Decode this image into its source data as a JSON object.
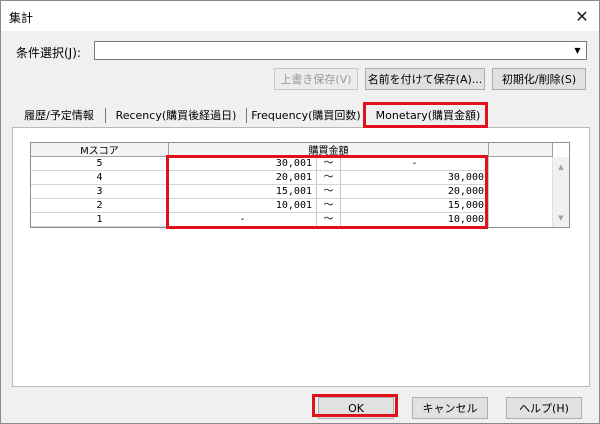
{
  "window": {
    "title": "集計",
    "close_glyph": "✕"
  },
  "condition": {
    "label": "条件選択(J):",
    "value": "",
    "dropdown_glyph": "▼"
  },
  "toolbar": {
    "overwrite_save": "上書き保存(V)",
    "save_as": "名前を付けて保存(A)...",
    "reset_delete": "初期化/削除(S)"
  },
  "tabs": [
    {
      "label": "履歴/予定情報",
      "active": false
    },
    {
      "label": "Recency(購買後経過日)",
      "active": false
    },
    {
      "label": "Frequency(購買回数)",
      "active": false
    },
    {
      "label": "Monetary(購買金額)",
      "active": true
    }
  ],
  "grid": {
    "columns": {
      "score": "Mスコア",
      "amount": "購買金額"
    },
    "rows": [
      {
        "score": "5",
        "from": "30,001",
        "tilde": "〜",
        "to": "-"
      },
      {
        "score": "4",
        "from": "20,001",
        "tilde": "〜",
        "to": "30,000"
      },
      {
        "score": "3",
        "from": "15,001",
        "tilde": "〜",
        "to": "20,000"
      },
      {
        "score": "2",
        "from": "10,001",
        "tilde": "〜",
        "to": "15,000"
      },
      {
        "score": "1",
        "from": "-",
        "tilde": "〜",
        "to": "10,000"
      }
    ],
    "scroll_up_glyph": "▲",
    "scroll_down_glyph": "▼"
  },
  "footer": {
    "ok": "OK",
    "cancel": "キャンセル",
    "help": "ヘルプ(H)"
  },
  "colors": {
    "highlight": "#e0111b",
    "dialog_bg": "#f0f0f0"
  }
}
